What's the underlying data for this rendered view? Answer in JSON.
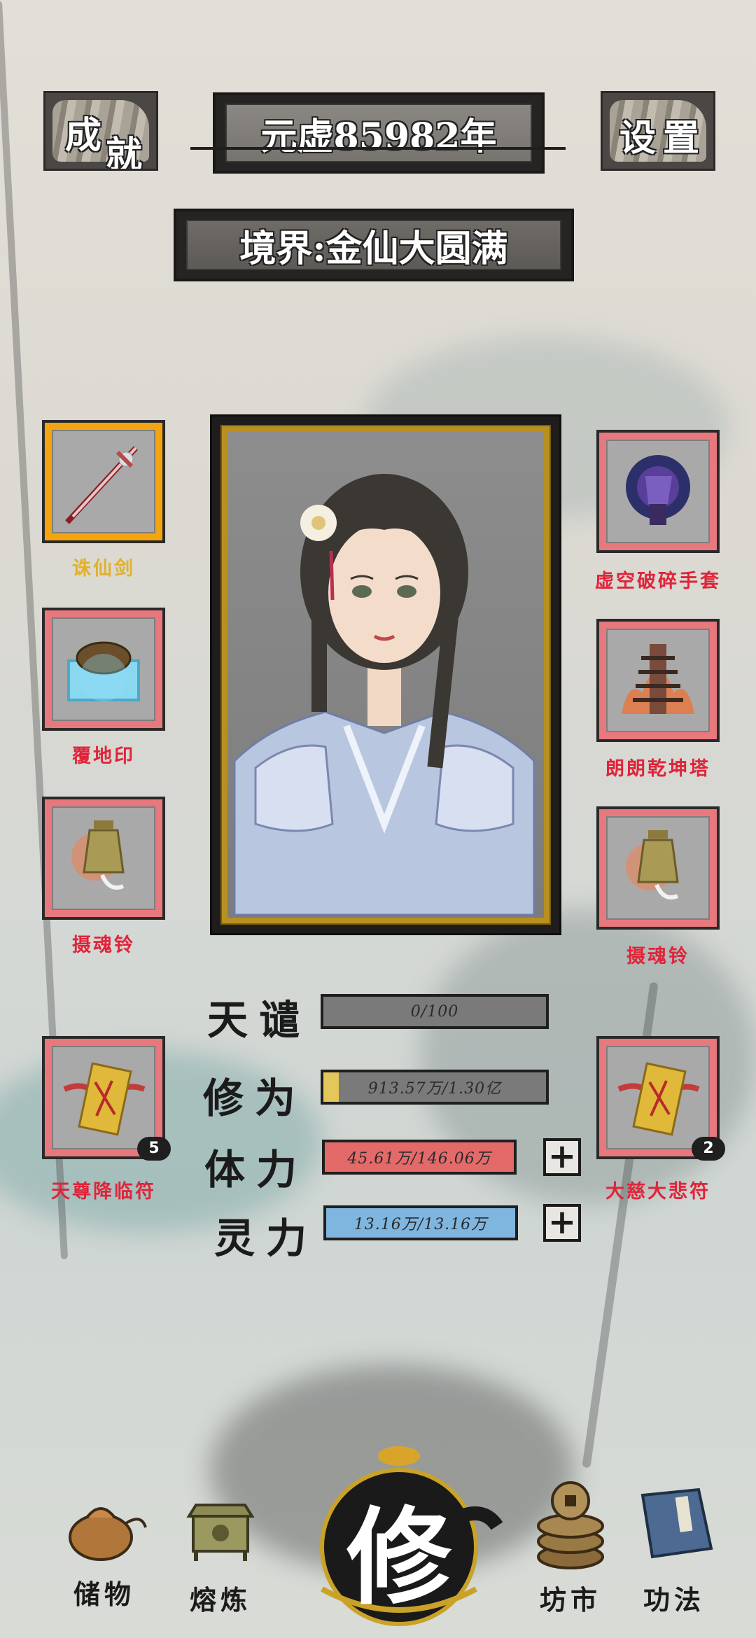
{
  "header": {
    "achievements_label": [
      "成",
      "就"
    ],
    "year_text": "元虚85982年",
    "settings_label": "设置"
  },
  "realm": {
    "text": "境界:金仙大圆满"
  },
  "equipment": {
    "left": [
      {
        "label": "诛仙剑",
        "icon": "sword-icon",
        "highlight": true
      },
      {
        "label": "覆地印",
        "icon": "turtle-seal-icon"
      },
      {
        "label": "摄魂铃",
        "icon": "bell-icon"
      },
      {
        "label": "天尊降临符",
        "icon": "talisman-icon",
        "count": "5"
      }
    ],
    "right": [
      {
        "label": "虚空破碎手套",
        "icon": "glove-icon"
      },
      {
        "label": "朗朗乾坤塔",
        "icon": "pagoda-icon"
      },
      {
        "label": "摄魂铃",
        "icon": "bell-icon"
      },
      {
        "label": "大慈大悲符",
        "icon": "talisman-icon",
        "count": "2"
      }
    ]
  },
  "stats": [
    {
      "label": "天谴",
      "value": "0/100",
      "fill": 0.0,
      "color": "#7a7a7a",
      "plus": false
    },
    {
      "label": "修为",
      "value": "913.57万/1.30亿",
      "fill": 0.07,
      "color": "#e4c75a",
      "plus": false
    },
    {
      "label": "体力",
      "value": "45.61万/146.06万",
      "fill": 1.0,
      "color": "#e46a6a",
      "plus": true
    },
    {
      "label": "灵力",
      "value": "13.16万/13.16万",
      "fill": 1.0,
      "color": "#7fb6e0",
      "plus": true
    }
  ],
  "nav": {
    "storage": "储物",
    "refine": "熔炼",
    "cultivate": "修",
    "market": "坊市",
    "techniques": "功法"
  },
  "colors": {
    "slot_red": "#e7787e",
    "slot_gold": "#f2a50f",
    "label_red": "#e0243a",
    "label_gold": "#e2b12a"
  }
}
